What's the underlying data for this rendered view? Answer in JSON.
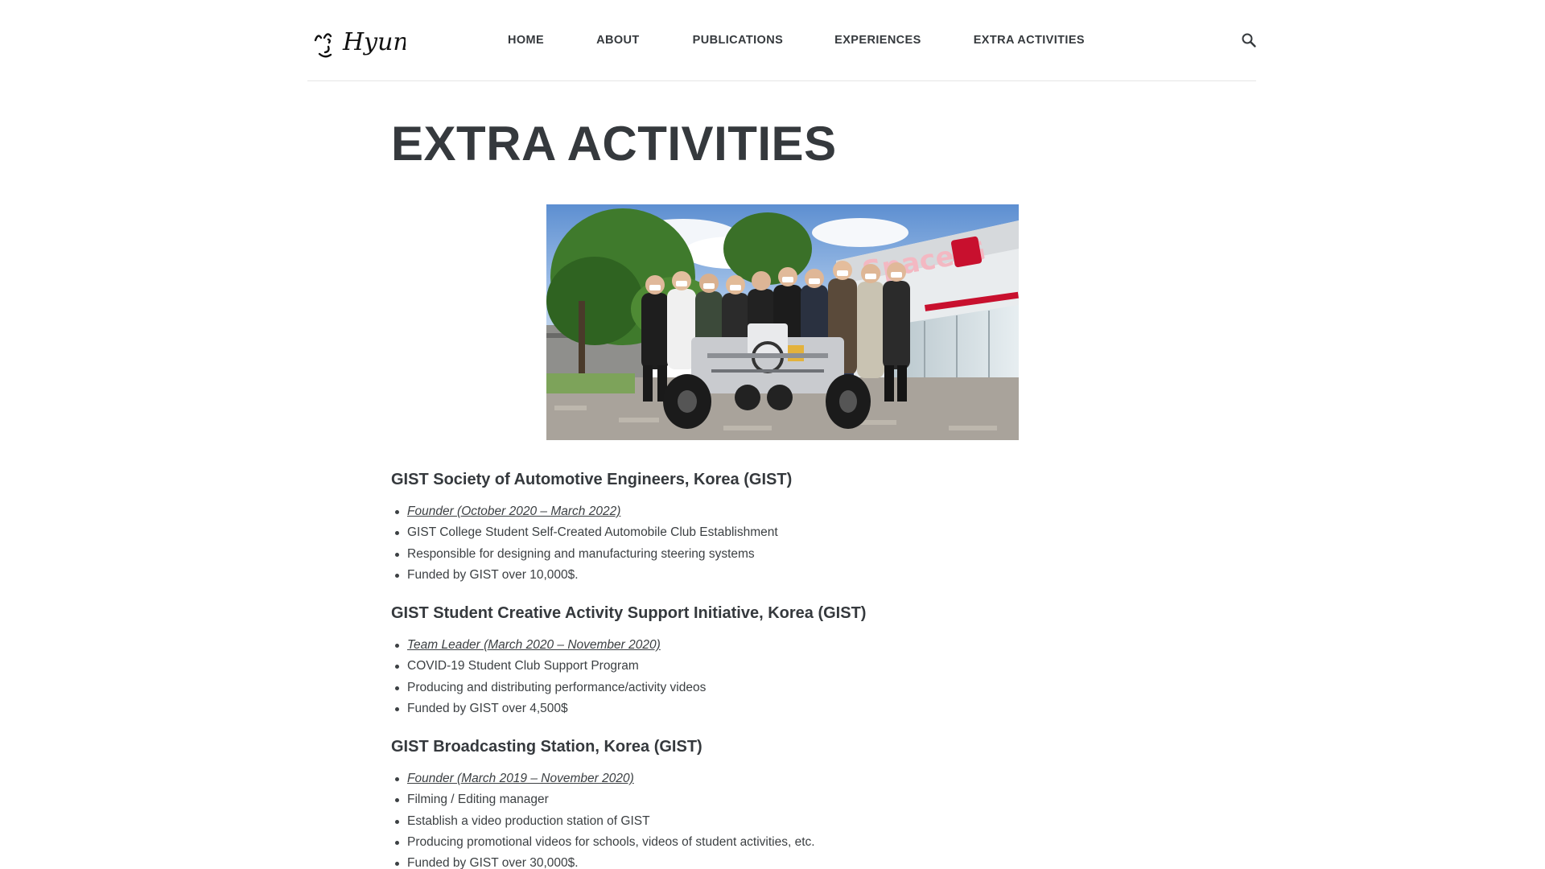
{
  "header": {
    "logo_text": "Hyun!",
    "nav": {
      "home": "HOME",
      "about": "ABOUT",
      "publications": "PUBLICATIONS",
      "experiences": "EXPERIENCES",
      "extra_activities": "EXTRA ACTIVITIES"
    },
    "search_icon": "search-icon"
  },
  "page": {
    "title": "EXTRA ACTIVITIES",
    "hero_image_sign_text": "Space G"
  },
  "sections": [
    {
      "heading": "GIST Society of Automotive Engineers, Korea (GIST)",
      "role": "Founder (October 2020 – March 2022)",
      "items": [
        "GIST College Student Self-Created Automobile Club Establishment",
        "Responsible for designing and manufacturing steering systems",
        "Funded by GIST over 10,000$."
      ]
    },
    {
      "heading": "GIST Student Creative Activity Support Initiative, Korea (GIST)",
      "role": "Team Leader (March 2020 – November 2020)",
      "items": [
        "COVID-19 Student Club Support Program",
        "Producing and distributing performance/activity videos",
        "Funded by GIST over 4,500$"
      ]
    },
    {
      "heading": "GIST Broadcasting Station, Korea (GIST)",
      "role": "Founder (March 2019 – November 2020)",
      "items": [
        "Filming / Editing manager",
        "Establish a video production station of GIST",
        "Producing promotional videos for schools, videos of student activities, etc.",
        "Funded by GIST over 30,000$."
      ]
    }
  ]
}
